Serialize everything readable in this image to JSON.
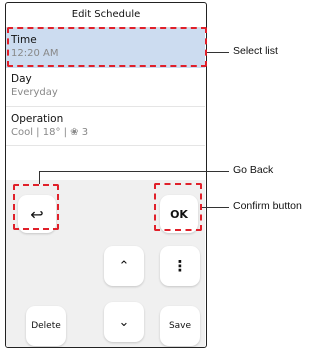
{
  "screen": {
    "title": "Edit Schedule",
    "items": [
      {
        "label": "Time",
        "value": "12:20 AM"
      },
      {
        "label": "Day",
        "value": "Everyday"
      },
      {
        "label": "Operation",
        "value": "Cool  | 18° |  ❀ 3"
      }
    ]
  },
  "buttons": {
    "back_icon": "↩",
    "ok_label": "OK",
    "up_icon": "⌃",
    "more_icon": "⋮",
    "delete_label": "Delete",
    "down_icon": "⌄",
    "save_label": "Save"
  },
  "callouts": {
    "select_list": "Select list",
    "go_back": "Go Back",
    "confirm": "Confirm button"
  },
  "colors": {
    "selected_row": "#ccdcf0",
    "highlight_dash": "#e0202a",
    "panel_bg": "#f0f0f0"
  }
}
